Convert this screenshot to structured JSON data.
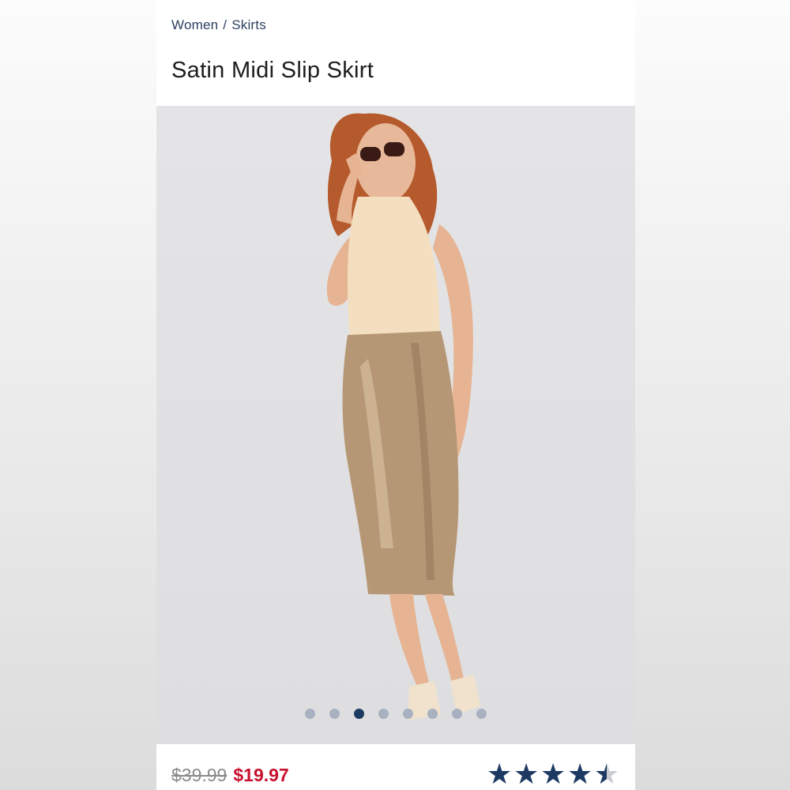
{
  "breadcrumb": {
    "category": "Women",
    "separator": "/",
    "subcategory": "Skirts"
  },
  "product": {
    "title": "Satin Midi Slip Skirt",
    "image_icon": "product-photo-model-in-satin-skirt",
    "price_original": "$39.99",
    "price_sale": "$19.97",
    "rating_value": 4.5,
    "rating_max": 5
  },
  "carousel": {
    "total_images": 8,
    "active_index": 2
  },
  "colors": {
    "breadcrumb": "#2c3f5e",
    "sale_price": "#c8102e",
    "star": "#1d3a63",
    "dot_active": "#1d3a63",
    "dot_inactive": "#a8b1bf"
  }
}
